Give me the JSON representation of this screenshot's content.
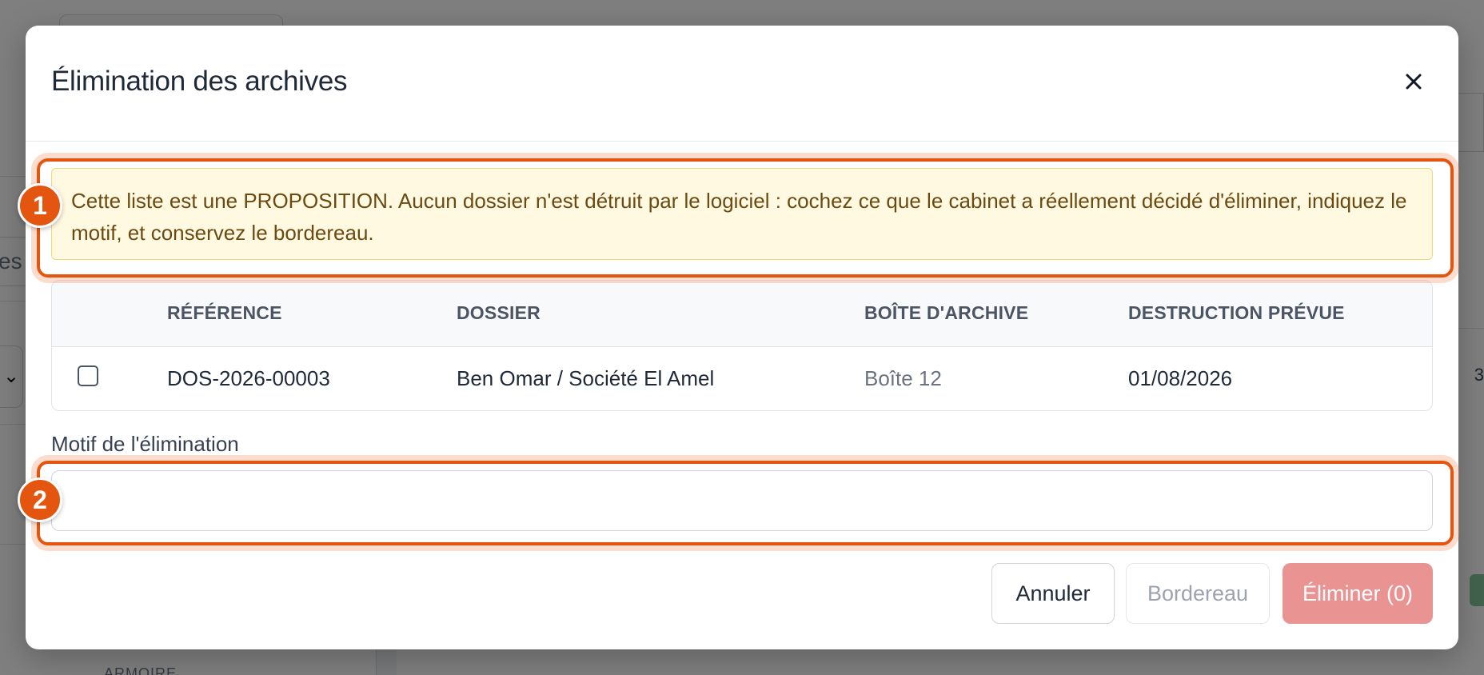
{
  "modal": {
    "title": "Élimination des archives",
    "alert_text": "Cette liste est une PROPOSITION. Aucun dossier n'est détruit par le logiciel : cochez ce que le cabinet a réellement décidé d'éliminer, indiquez le motif, et conservez le bordereau.",
    "table": {
      "columns": [
        "RÉFÉRENCE",
        "DOSSIER",
        "BOÎTE D'ARCHIVE",
        "DESTRUCTION PRÉVUE"
      ],
      "rows": [
        {
          "checked": false,
          "reference": "DOS-2026-00003",
          "dossier": "Ben Omar / Société El Amel",
          "boite": "Boîte 12",
          "destruction": "01/08/2026"
        }
      ]
    },
    "motif": {
      "label": "Motif de l'élimination",
      "value": "",
      "placeholder": ""
    },
    "buttons": {
      "cancel": "Annuler",
      "bordereau": "Bordereau",
      "eliminer": "Éliminer (0)"
    }
  },
  "highlights": [
    {
      "number": "1",
      "target": "alert"
    },
    {
      "number": "2",
      "target": "motif-input"
    }
  ],
  "background": {
    "search_fragment": "es",
    "number_fragment": "3",
    "bottom_text": "ARMOIRE"
  },
  "colors": {
    "highlight": "#e4550f",
    "alert_bg": "#fff9e1",
    "alert_text": "#6b4a12",
    "danger_disabled": "#e99393"
  }
}
